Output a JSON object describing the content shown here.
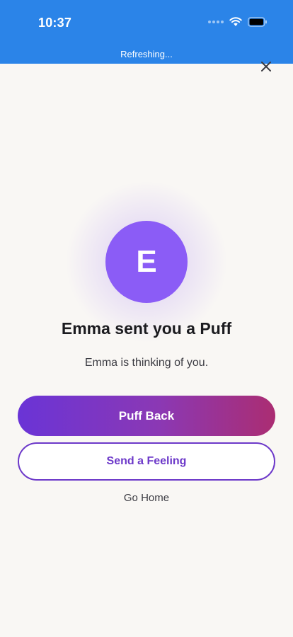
{
  "status_bar": {
    "time": "10:37",
    "background": "#2b84e8",
    "refresh_text": "Refreshing...",
    "icons": [
      "cellular-icon",
      "wifi-icon",
      "battery-icon"
    ]
  },
  "header": {
    "close_icon": "close-icon"
  },
  "sender": {
    "initial": "E",
    "avatar_color": "#8b5cf6"
  },
  "message": {
    "title": "Emma sent you a Puff",
    "subtitle": "Emma is thinking of you."
  },
  "actions": {
    "primary_label": "Puff Back",
    "secondary_label": "Send a Feeling",
    "tertiary_label": "Go Home",
    "accent": "#6c38c9"
  }
}
